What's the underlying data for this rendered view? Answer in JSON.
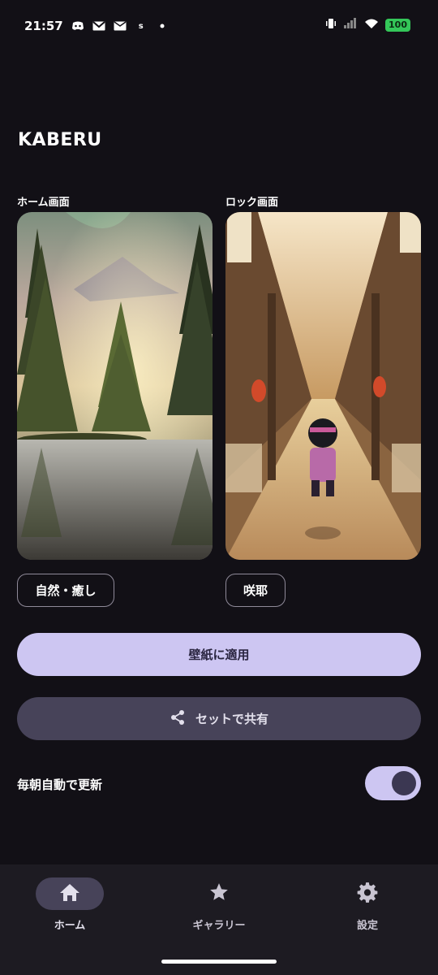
{
  "status_bar": {
    "time": "21:57",
    "battery": "100",
    "icons_left": [
      "discord-icon",
      "gmail-icon",
      "mail-icon",
      "s-app-icon",
      "dot-icon"
    ],
    "icons_right": [
      "vibrate-icon",
      "signal-icon",
      "wifi-icon",
      "battery-icon"
    ]
  },
  "app": {
    "title": "KABERU"
  },
  "home_preview": {
    "label": "ホーム画面",
    "category": "自然・癒し"
  },
  "lock_preview": {
    "label": "ロック画面",
    "category": "咲耶"
  },
  "actions": {
    "apply_label": "壁紙に適用",
    "share_label": "セットで共有"
  },
  "settings": {
    "auto_update_label": "毎朝自動で更新",
    "auto_update_enabled": true
  },
  "nav": {
    "items": [
      {
        "label": "ホーム",
        "icon": "home-icon",
        "active": true
      },
      {
        "label": "ギャラリー",
        "icon": "star-icon",
        "active": false
      },
      {
        "label": "設定",
        "icon": "gear-icon",
        "active": false
      }
    ]
  },
  "colors": {
    "background": "#121016",
    "primary": "#cdc6f2",
    "secondary": "#474359",
    "nav_bg": "#1d1b22"
  }
}
